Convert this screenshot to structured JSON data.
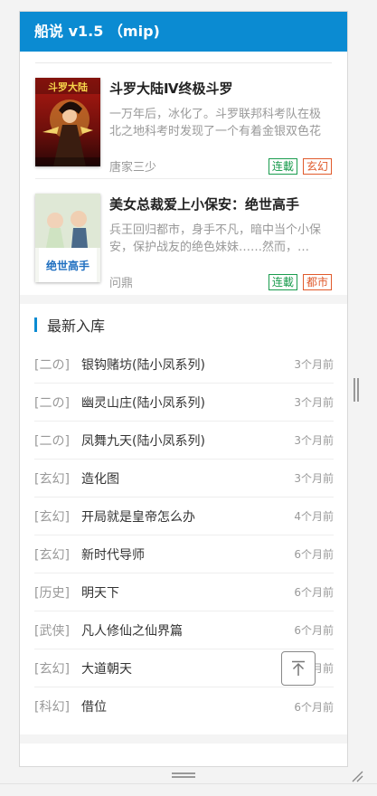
{
  "header": {
    "title": "船说 v1.5 （mip)"
  },
  "featured": [
    {
      "title": "斗罗大陆Ⅳ终极斗罗",
      "desc": "一万年后，冰化了。斗罗联邦科考队在极北之地科考时发现了一个有着金银双色花纹的蛋…",
      "author": "唐家三少",
      "status": "连載",
      "genre": "玄幻"
    },
    {
      "title": "美女总裁爱上小保安：绝世高手",
      "desc": "兵王回归都市，身手不凡，暗中当个小保安，保护战友的绝色妹妹……然而，…",
      "author": "问鼎",
      "status": "连載",
      "genre": "都市"
    }
  ],
  "latest": {
    "heading": "最新入库",
    "items": [
      {
        "cat": "[二の]",
        "name": "银钩赌坊(陆小凤系列)",
        "time": "3个月前"
      },
      {
        "cat": "[二の]",
        "name": "幽灵山庄(陆小凤系列)",
        "time": "3个月前"
      },
      {
        "cat": "[二の]",
        "name": "凤舞九天(陆小凤系列)",
        "time": "3个月前"
      },
      {
        "cat": "[玄幻]",
        "name": "造化图",
        "time": "3个月前"
      },
      {
        "cat": "[玄幻]",
        "name": "开局就是皇帝怎么办",
        "time": "4个月前"
      },
      {
        "cat": "[玄幻]",
        "name": "新时代导师",
        "time": "6个月前"
      },
      {
        "cat": "[历史]",
        "name": "明天下",
        "time": "6个月前"
      },
      {
        "cat": "[武侠]",
        "name": "凡人修仙之仙界篇",
        "time": "6个月前"
      },
      {
        "cat": "[玄幻]",
        "name": "大道朝天",
        "time": "6个月前"
      },
      {
        "cat": "[科幻]",
        "name": "借位",
        "time": "6个月前"
      }
    ]
  },
  "cover_texts": {
    "book1": "斗罗大陆",
    "book2": "绝世高手"
  },
  "colors": {
    "accent": "#0b8bd2",
    "tag_green": "#1a9c4e",
    "tag_red": "#e05a2b"
  },
  "icons": {
    "back_to_top": "arrow-up-icon",
    "resize": "resize-grip-icon"
  }
}
